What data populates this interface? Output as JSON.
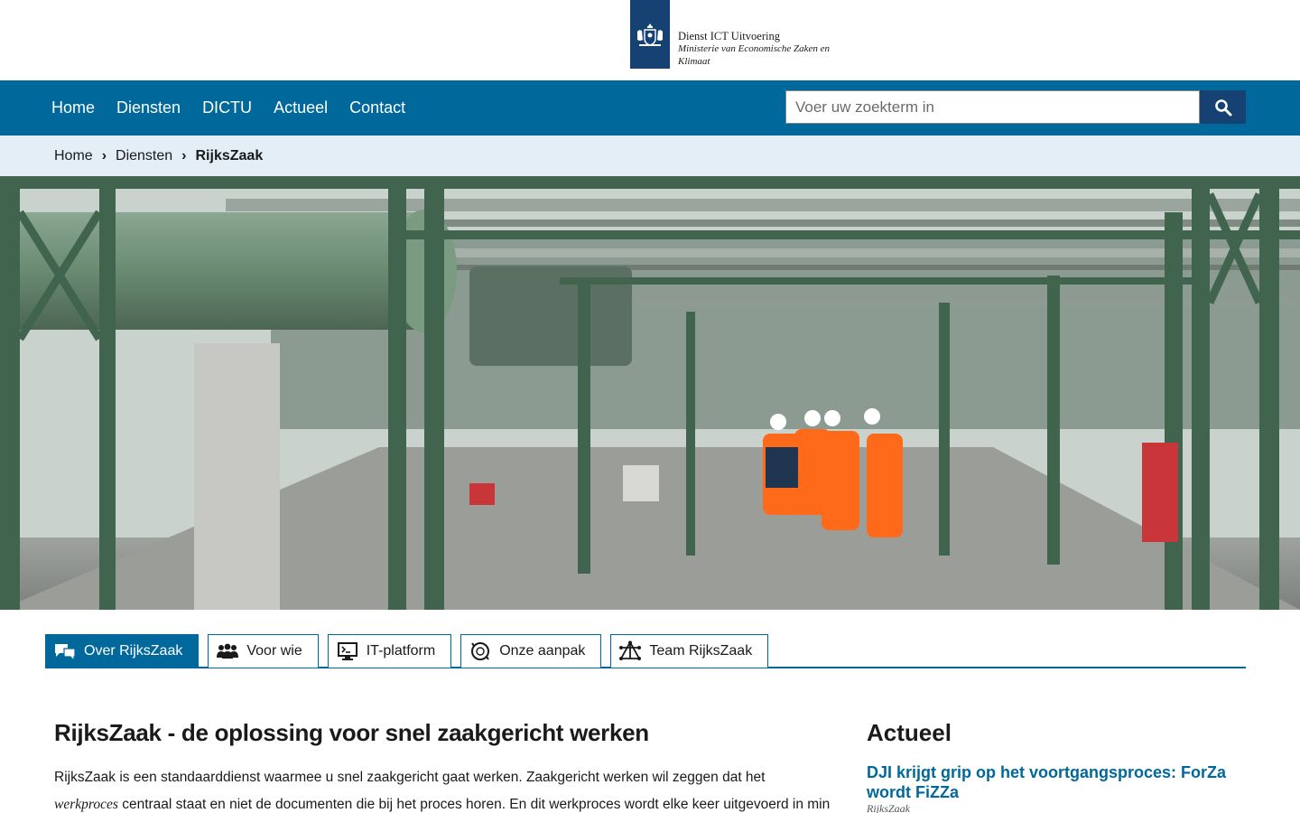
{
  "header": {
    "org_name": "Dienst ICT Uitvoering",
    "ministry": "Ministerie van Economische Zaken en Klimaat"
  },
  "nav": {
    "items": [
      "Home",
      "Diensten",
      "DICTU",
      "Actueel",
      "Contact"
    ],
    "search_placeholder": "Voer uw zoekterm in"
  },
  "breadcrumb": {
    "items": [
      "Home",
      "Diensten"
    ],
    "current": "RijksZaak"
  },
  "tabs": [
    {
      "label": "Over RijksZaak",
      "icon": "chat-icon",
      "active": true
    },
    {
      "label": "Voor wie",
      "icon": "people-icon",
      "active": false
    },
    {
      "label": "IT-platform",
      "icon": "monitor-icon",
      "active": false
    },
    {
      "label": "Onze aanpak",
      "icon": "cycle-icon",
      "active": false
    },
    {
      "label": "Team RijksZaak",
      "icon": "network-icon",
      "active": false
    }
  ],
  "main": {
    "title": "RijksZaak - de oplossing voor snel zaakgericht werken",
    "text_part1": "RijksZaak is een standaarddienst waarmee u snel zaakgericht gaat werken. Zaakgericht werken wil zeggen dat het ",
    "text_em": "werkproces",
    "text_part2": " centraal staat en niet de documenten die bij het proces horen. En dit werkproces wordt elke keer uitgevoerd in min of meer"
  },
  "sidebar": {
    "title": "Actueel",
    "news_title": "DJI krijgt grip op het voortgangsproces: ForZa wordt FiZZa",
    "news_meta": "RijksZaak"
  },
  "colors": {
    "nav": "#01689b",
    "logo": "#154273",
    "breadcrumb_bg": "#e4eef7"
  }
}
